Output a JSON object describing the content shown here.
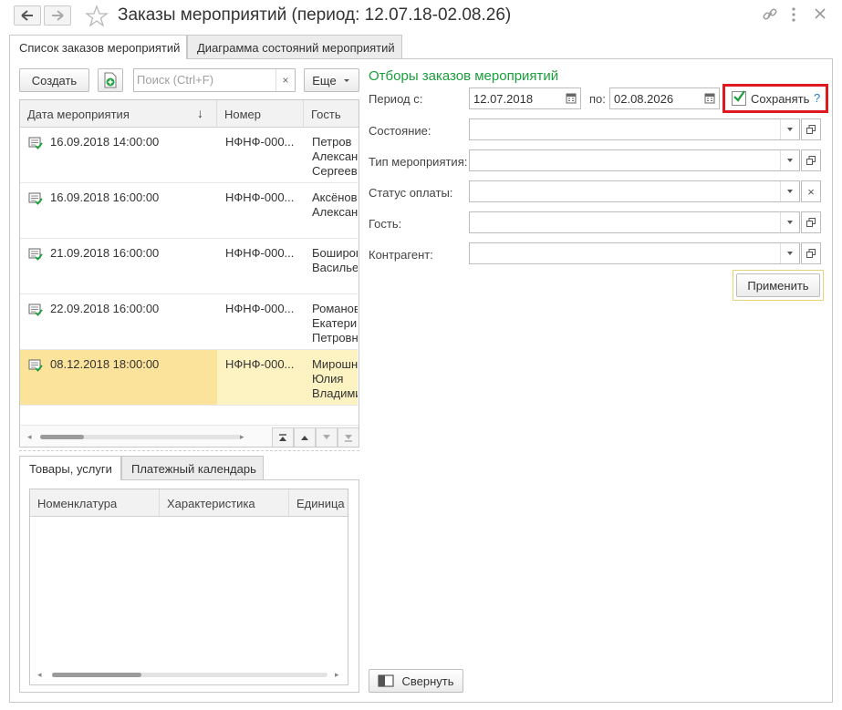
{
  "window": {
    "title": "Заказы мероприятий (период: 12.07.18-02.08.26)"
  },
  "tabs": [
    {
      "label": "Список заказов мероприятий"
    },
    {
      "label": "Диаграмма состояний мероприятий"
    }
  ],
  "toolbar": {
    "create_label": "Создать",
    "search_placeholder": "Поиск (Ctrl+F)",
    "more_label": "Еще"
  },
  "table": {
    "columns": [
      "Дата мероприятия",
      "Номер",
      "Гость"
    ],
    "rows": [
      {
        "date": "16.09.2018 14:00:00",
        "number": "НФНФ-000...",
        "guest": [
          "Петров",
          "Александр",
          "Сергеевич"
        ]
      },
      {
        "date": "16.09.2018 16:00:00",
        "number": "НФНФ-000...",
        "guest": [
          "Аксёнов",
          "Александр"
        ]
      },
      {
        "date": "21.09.2018 16:00:00",
        "number": "НФНФ-000...",
        "guest": [
          "Боширов",
          "Васильевич"
        ]
      },
      {
        "date": "22.09.2018 16:00:00",
        "number": "НФНФ-000...",
        "guest": [
          "Романова",
          "Екатерина",
          "Петровна"
        ]
      },
      {
        "date": "08.12.2018 18:00:00",
        "number": "НФНФ-000...",
        "guest": [
          "Мирошниченко",
          "Юлия",
          "Владимировна"
        ]
      }
    ],
    "selected_row": 4
  },
  "bottom_tabs": [
    {
      "label": "Товары, услуги"
    },
    {
      "label": "Платежный календарь"
    }
  ],
  "goods_table": {
    "columns": [
      "Номенклатура",
      "Характеристика",
      "Единица"
    ]
  },
  "filters": {
    "heading": "Отборы заказов мероприятий",
    "period_from_label": "Период с:",
    "period_from_value": "12.07.2018",
    "period_to_label": "по:",
    "period_to_value": "02.08.2026",
    "save_label": "Сохранять",
    "save_checked": true,
    "help_label": "?",
    "state_label": "Состояние:",
    "event_type_label": "Тип мероприятия:",
    "payment_status_label": "Статус оплаты:",
    "guest_label": "Гость:",
    "counterparty_label": "Контрагент:",
    "apply_label": "Применить",
    "collapse_label": "Свернуть"
  },
  "colors": {
    "accent_green": "#1a9e3c",
    "highlight_red": "#e0191f",
    "selected_row": "#fbe39b"
  }
}
